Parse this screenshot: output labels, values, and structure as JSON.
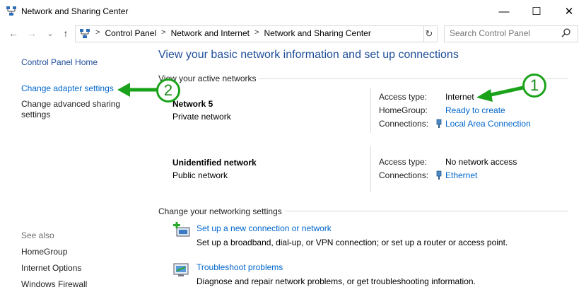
{
  "window": {
    "title": "Network and Sharing Center",
    "minimize_glyph": "—",
    "maximize_glyph": "☐",
    "close_glyph": "✕"
  },
  "nav": {
    "back_glyph": "←",
    "forward_glyph": "→",
    "recent_glyph": "⌄",
    "up_glyph": "↑",
    "refresh_glyph": "↻",
    "breadcrumbs": [
      "Control Panel",
      "Network and Internet",
      "Network and Sharing Center"
    ],
    "search_placeholder": "Search Control Panel"
  },
  "sidebar": {
    "home": "Control Panel Home",
    "change_adapter": "Change adapter settings",
    "change_sharing_line1": "Change advanced sharing",
    "change_sharing_line2": "settings",
    "see_also": "See also",
    "see_also_items": [
      "HomeGroup",
      "Internet Options",
      "Windows Firewall"
    ]
  },
  "main": {
    "heading": "View your basic network information and set up connections",
    "active_networks_label": "View your active networks",
    "networks": [
      {
        "name": "Network  5",
        "category": "Private network",
        "access_label": "Access type:",
        "access_value": "Internet",
        "homegroup_label": "HomeGroup:",
        "homegroup_value": "Ready to create",
        "connections_label": "Connections:",
        "connection_value": "Local Area Connection"
      },
      {
        "name": "Unidentified network",
        "category": "Public network",
        "access_label": "Access type:",
        "access_value": "No network access",
        "connections_label": "Connections:",
        "connection_value": "Ethernet"
      }
    ],
    "settings_label": "Change your networking settings",
    "tasks": [
      {
        "title": "Set up a new connection or network",
        "description": "Set up a broadband, dial-up, or VPN connection; or set up a router or access point."
      },
      {
        "title": "Troubleshoot problems",
        "description": "Diagnose and repair network problems, or get troubleshooting information."
      }
    ]
  },
  "annotations": {
    "badge1": "1",
    "badge2": "2",
    "color": "#1aa31a"
  },
  "colors": {
    "link": "#0066cc",
    "heading": "#1e4e99",
    "divider": "#d9d9d9"
  }
}
